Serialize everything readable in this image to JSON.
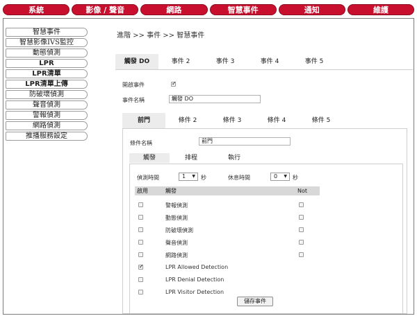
{
  "topnav": [
    "系統",
    "影像 / 聲音",
    "網路",
    "智慧事件",
    "通知",
    "維護"
  ],
  "sidebar": [
    "智慧事件",
    "智慧影像IVS監控",
    "動態偵測",
    "LPR",
    "LPR清單",
    "LPR清單上傳",
    "防破壞偵測",
    "聲音偵測",
    "警報偵測",
    "網路偵測",
    "推播服務設定"
  ],
  "breadcrumb": "進階 >> 事件 >> 智慧事件",
  "event_tabs": [
    "觸發 DO",
    "事件 2",
    "事件 3",
    "事件 4",
    "事件 5"
  ],
  "enable_event_label": "開啟事件",
  "event_name_label": "事件名稱",
  "event_name_value": "觸發 DO",
  "condition_tabs": [
    "前門",
    "條件 2",
    "條件 3",
    "條件 4",
    "條件 5"
  ],
  "condition_name_label": "條件名稱",
  "condition_name_value": "前門",
  "sub_tabs": [
    "觸發",
    "排程",
    "執行"
  ],
  "detect_time_label": "偵測時間",
  "detect_time_value": "1",
  "detect_time_unit": "秒",
  "rest_time_label": "休息時間",
  "rest_time_value": "0",
  "rest_time_unit": "秒",
  "table_header": {
    "enable": "啟用",
    "trigger": "觸發",
    "not": "Not"
  },
  "triggers": [
    {
      "label": "警報偵測",
      "enabled": false,
      "not": false,
      "has_not": true
    },
    {
      "label": "動態偵測",
      "enabled": false,
      "not": false,
      "has_not": true
    },
    {
      "label": "防破壞偵測",
      "enabled": false,
      "not": false,
      "has_not": true
    },
    {
      "label": "聲音偵測",
      "enabled": false,
      "not": false,
      "has_not": true
    },
    {
      "label": "網路偵測",
      "enabled": false,
      "not": false,
      "has_not": true
    },
    {
      "label": "LPR Allowed Detection",
      "enabled": true,
      "not": false,
      "has_not": false
    },
    {
      "label": "LPR Denial Detection",
      "enabled": false,
      "not": false,
      "has_not": false
    },
    {
      "label": "LPR Visitor Detection",
      "enabled": false,
      "not": false,
      "has_not": false
    }
  ],
  "save_label": "儲存事件"
}
